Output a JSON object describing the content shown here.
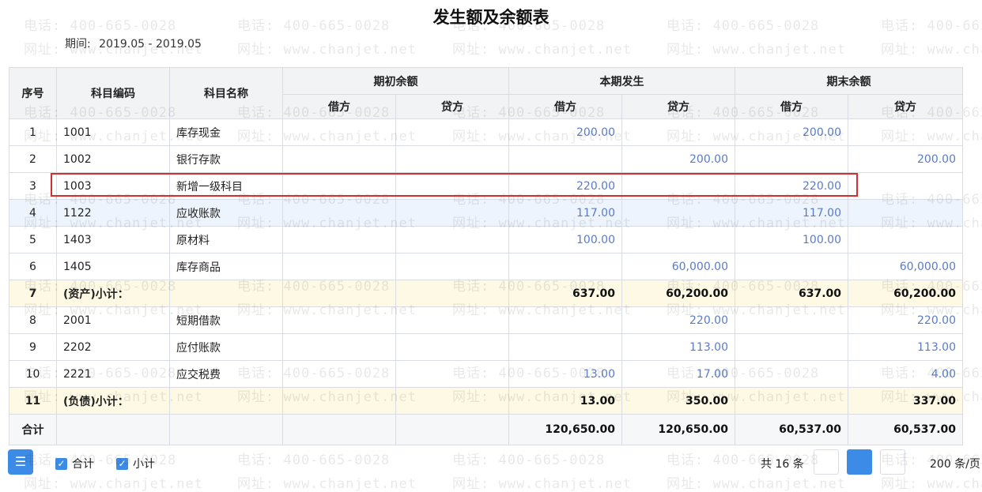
{
  "report": {
    "title": "发生额及余额表",
    "period_label": "期间:",
    "period_value": "2019.05 - 2019.05"
  },
  "table": {
    "headers": {
      "seq": "序号",
      "code": "科目编码",
      "name": "科目名称",
      "opening": "期初余额",
      "current": "本期发生",
      "closing": "期末余额",
      "debit": "借方",
      "credit": "贷方"
    },
    "rows": [
      {
        "seq": "1",
        "code": "1001",
        "name": "库存现金",
        "op_dr": "",
        "op_cr": "",
        "cur_dr": "200.00",
        "cur_cr": "",
        "cl_dr": "200.00",
        "cl_cr": "",
        "type": "normal"
      },
      {
        "seq": "2",
        "code": "1002",
        "name": "银行存款",
        "op_dr": "",
        "op_cr": "",
        "cur_dr": "",
        "cur_cr": "200.00",
        "cl_dr": "",
        "cl_cr": "200.00",
        "type": "normal"
      },
      {
        "seq": "3",
        "code": "1003",
        "name": "新增一级科目",
        "op_dr": "",
        "op_cr": "",
        "cur_dr": "220.00",
        "cur_cr": "",
        "cl_dr": "220.00",
        "cl_cr": "",
        "type": "normal"
      },
      {
        "seq": "4",
        "code": "1122",
        "name": "应收账款",
        "op_dr": "",
        "op_cr": "",
        "cur_dr": "117.00",
        "cur_cr": "",
        "cl_dr": "117.00",
        "cl_cr": "",
        "type": "hl"
      },
      {
        "seq": "5",
        "code": "1403",
        "name": "原材料",
        "op_dr": "",
        "op_cr": "",
        "cur_dr": "100.00",
        "cur_cr": "",
        "cl_dr": "100.00",
        "cl_cr": "",
        "type": "normal"
      },
      {
        "seq": "6",
        "code": "1405",
        "name": "库存商品",
        "op_dr": "",
        "op_cr": "",
        "cur_dr": "",
        "cur_cr": "60,000.00",
        "cl_dr": "",
        "cl_cr": "60,000.00",
        "type": "normal"
      },
      {
        "seq": "7",
        "code": "(资产)小计：",
        "name": "",
        "op_dr": "",
        "op_cr": "",
        "cur_dr": "637.00",
        "cur_cr": "60,200.00",
        "cl_dr": "637.00",
        "cl_cr": "60,200.00",
        "type": "subtotal"
      },
      {
        "seq": "8",
        "code": "2001",
        "name": "短期借款",
        "op_dr": "",
        "op_cr": "",
        "cur_dr": "",
        "cur_cr": "220.00",
        "cl_dr": "",
        "cl_cr": "220.00",
        "type": "normal"
      },
      {
        "seq": "9",
        "code": "2202",
        "name": "应付账款",
        "op_dr": "",
        "op_cr": "",
        "cur_dr": "",
        "cur_cr": "113.00",
        "cl_dr": "",
        "cl_cr": "113.00",
        "type": "normal"
      },
      {
        "seq": "10",
        "code": "2221",
        "name": "应交税费",
        "op_dr": "",
        "op_cr": "",
        "cur_dr": "13.00",
        "cur_cr": "17.00",
        "cl_dr": "",
        "cl_cr": "4.00",
        "type": "normal"
      },
      {
        "seq": "11",
        "code": "(负债)小计：",
        "name": "",
        "op_dr": "",
        "op_cr": "",
        "cur_dr": "13.00",
        "cur_cr": "350.00",
        "cl_dr": "",
        "cl_cr": "337.00",
        "type": "subtotal"
      }
    ],
    "total": {
      "label": "合计",
      "cur_dr": "120,650.00",
      "cur_cr": "120,650.00",
      "cl_dr": "60,537.00",
      "cl_cr": "60,537.00"
    }
  },
  "footer": {
    "settings_icon": "column-settings-icon",
    "total_checkbox": "合计",
    "subtotal_checkbox": "小计",
    "records": "共 16 条",
    "page_size": "200 条/页"
  },
  "watermark": {
    "phone": "电话: 400-665-0028",
    "site": "网址: www.chanjet.net"
  },
  "colors": {
    "accent": "#3c8ce7",
    "amount_text": "#5b7cc4",
    "subtotal_bg": "#fdf9e4",
    "highlight_box": "#d32f2f"
  }
}
